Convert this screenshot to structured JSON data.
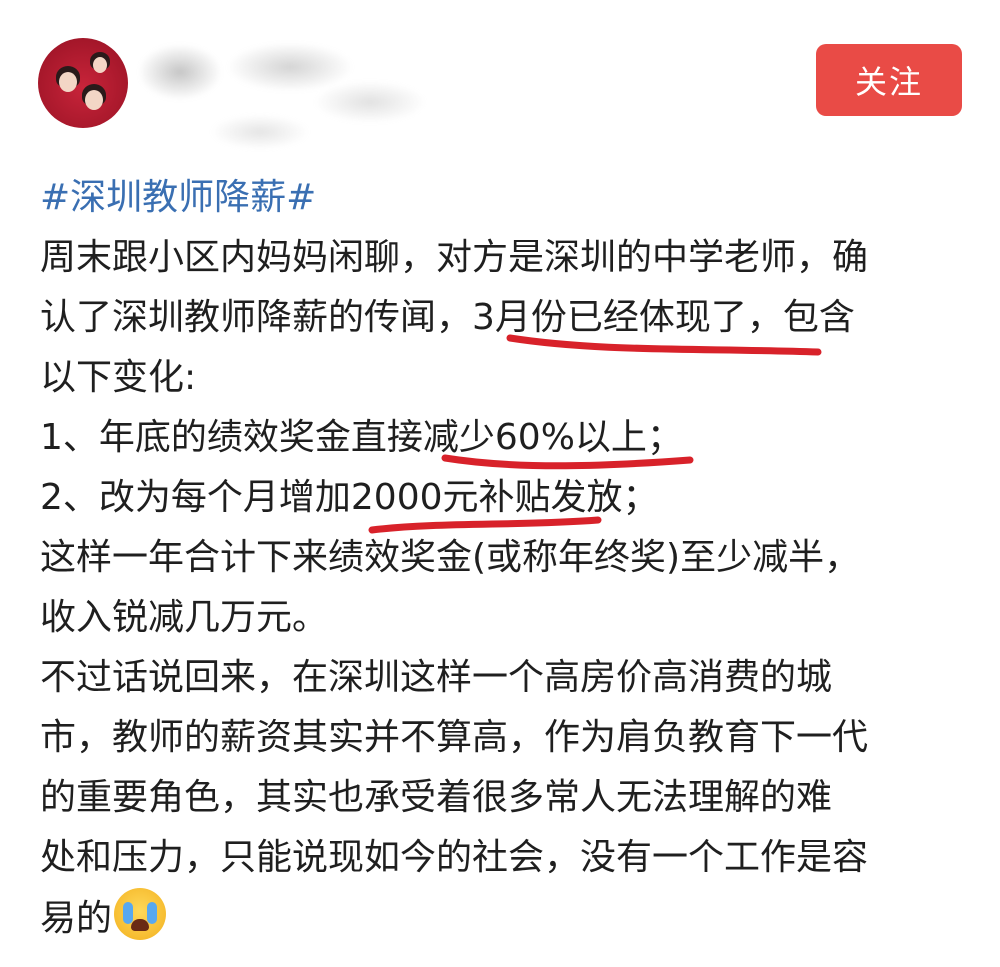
{
  "header": {
    "follow_label": "关注"
  },
  "post": {
    "hashtag": "#深圳教师降薪#",
    "lines": [
      "周末跟小区内妈妈闲聊，对方是深圳的中学老师，确",
      "认了深圳教师降薪的传闻，3月份已经体现了，包含",
      "以下变化:",
      "1、年底的绩效奖金直接减少60%以上；",
      "2、改为每个月增加2000元补贴发放；",
      "这样一年合计下来绩效奖金(或称年终奖)至少减半，",
      "收入锐减几万元。",
      "不过话说回来，在深圳这样一个高房价高消费的城",
      "市，教师的薪资其实并不算高，作为肩负教育下一代",
      "的重要角色，其实也承受着很多常人无法理解的难",
      "处和压力，只能说现如今的社会，没有一个工作是容",
      "易的"
    ],
    "emoji": "crying-face",
    "underline_color": "#d8222a"
  },
  "colors": {
    "follow_button": "#e94b46",
    "hashtag": "#3a6fb2",
    "text": "#1f1f1f"
  }
}
